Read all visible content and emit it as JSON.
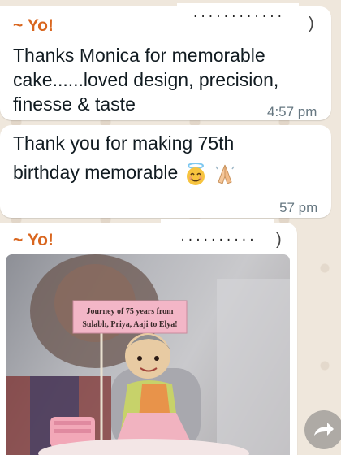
{
  "messages": [
    {
      "sender": "~ Yo!",
      "lines": [
        "Thanks Monica for memorable",
        "cake......loved design, precision,",
        "finesse & taste"
      ],
      "time": "4:57 pm"
    },
    {
      "lines": [
        "Thank you for making 75th",
        "birthday memorable"
      ],
      "time": "57 pm"
    },
    {
      "sender": "~ Yo!"
    }
  ],
  "redactions": [
    {
      "text": "............",
      "trailing": ")"
    },
    {
      "text": "..........",
      "trailing": ")"
    }
  ],
  "photo": {
    "sign_line1": "Journey of 75 years from",
    "sign_line2": "Sulabh, Priya, Aaji to Elya!"
  },
  "colors": {
    "sender": "#d9661f",
    "bubble": "#ffffff",
    "background": "#efe7dc",
    "timestamp": "#667781"
  },
  "icons": [
    "smiling-face-with-halo-icon",
    "folded-hands-icon",
    "forward-icon"
  ]
}
